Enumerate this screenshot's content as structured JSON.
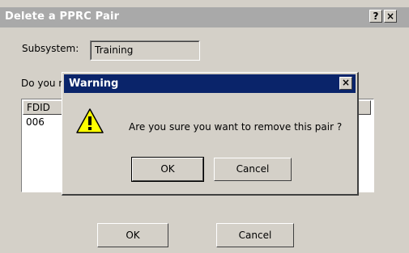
{
  "dialog": {
    "title": "Delete a PPRC Pair",
    "help_label": "?",
    "close_label": "×"
  },
  "subsystem": {
    "label": "Subsystem:",
    "value": "Training"
  },
  "prompt_partial": "Do you r",
  "table": {
    "header": "FDID",
    "rows": [
      "006"
    ]
  },
  "buttons": {
    "ok": "OK",
    "cancel": "Cancel"
  },
  "warning": {
    "title": "Warning",
    "close_label": "×",
    "icon": "exclamation-icon",
    "icon_color": "#ffff00",
    "message": "Are you sure you want to remove this pair ?",
    "ok": "OK",
    "cancel": "Cancel"
  },
  "colors": {
    "active_title": "#0a246a",
    "inactive_title": "#a9a9a9",
    "face": "#d4d0c8"
  }
}
